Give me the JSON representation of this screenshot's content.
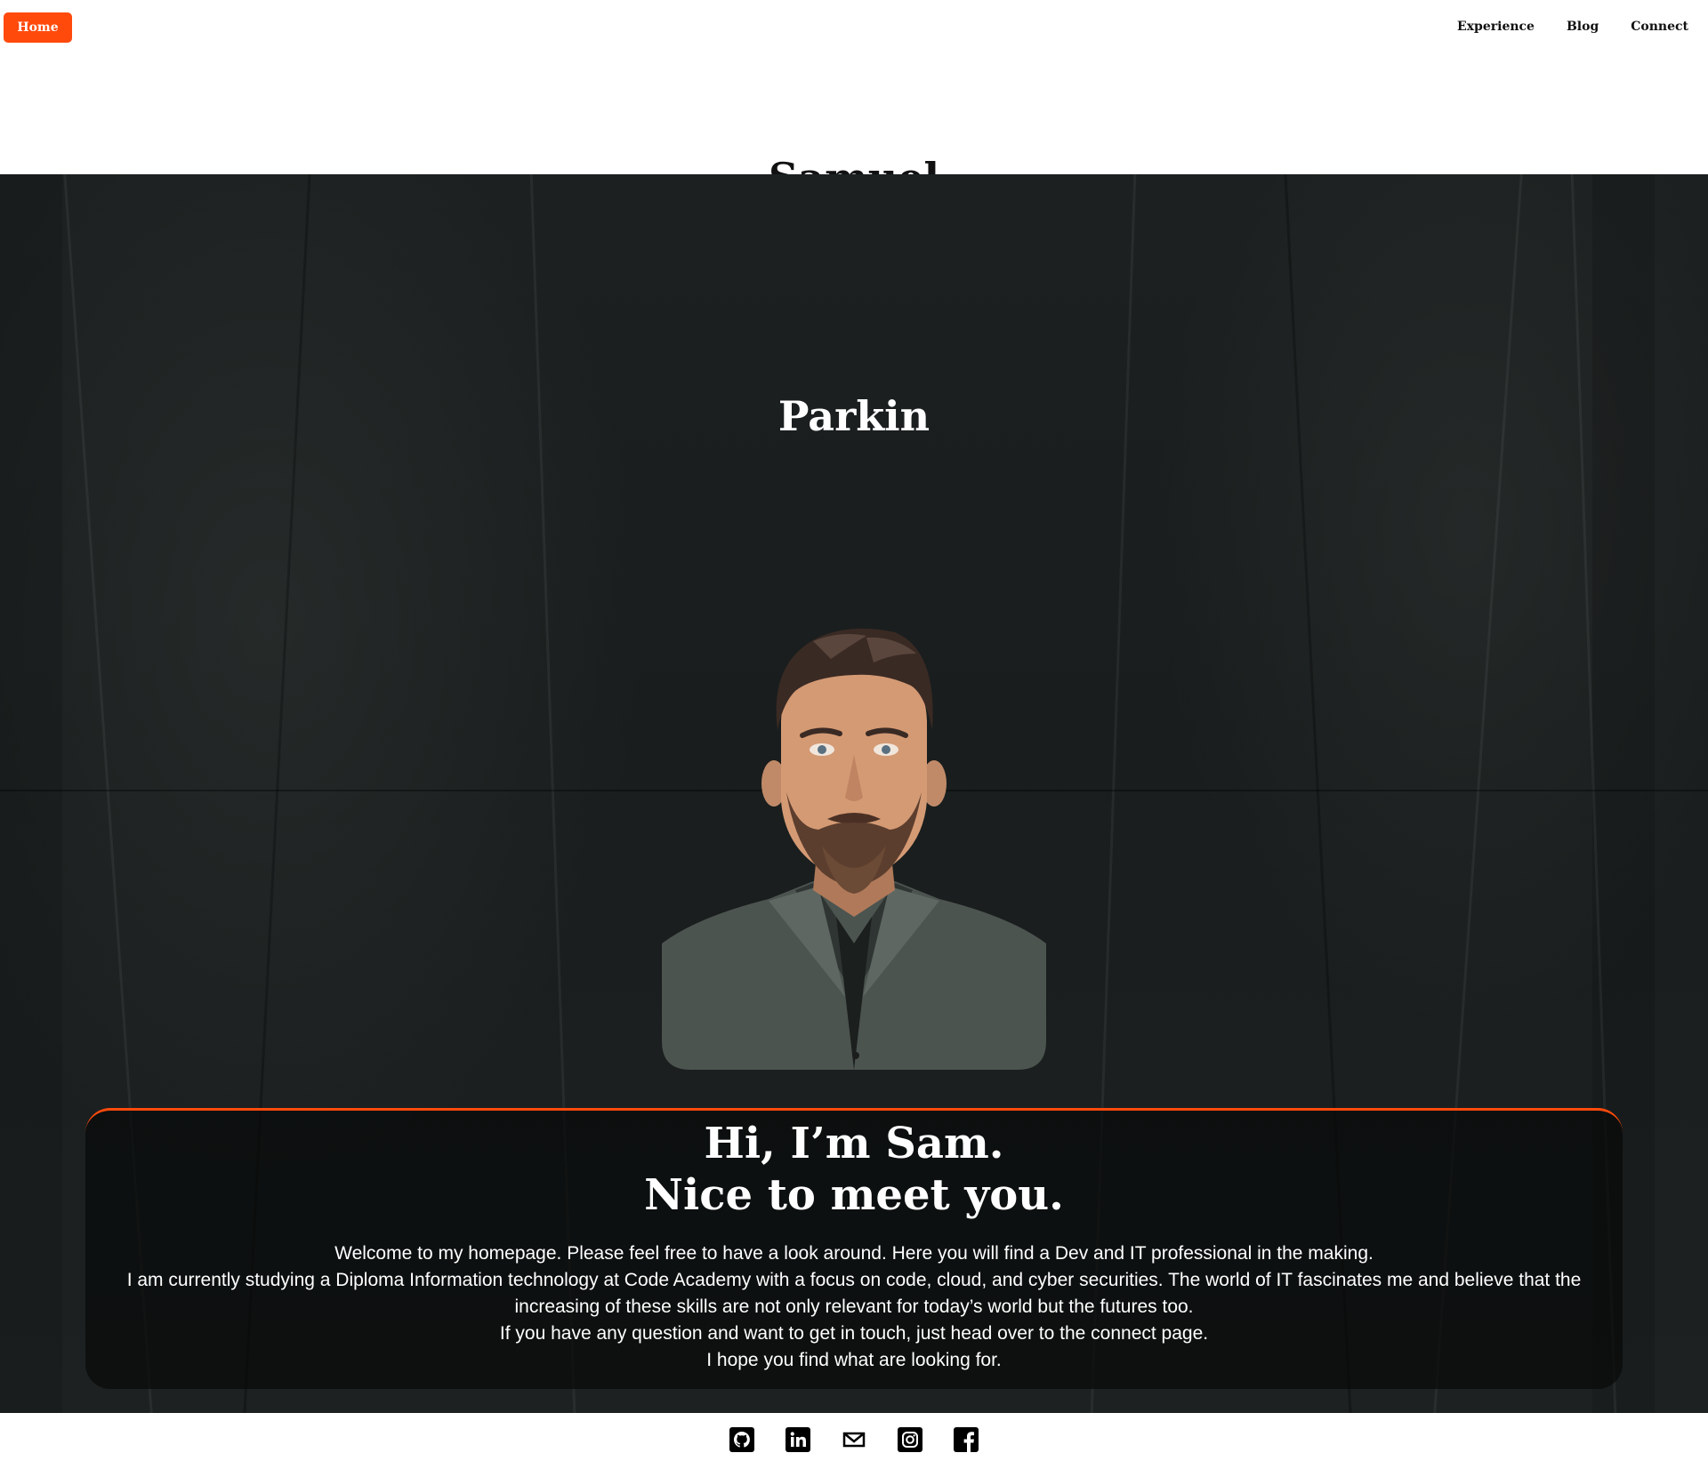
{
  "nav": {
    "home_label": "Home",
    "links": [
      {
        "label": "Experience"
      },
      {
        "label": "Blog"
      },
      {
        "label": "Connect"
      }
    ]
  },
  "hero": {
    "first_name": "Samuel",
    "last_name": "Parkin"
  },
  "intro": {
    "heading_line1": "Hi, I’m Sam.",
    "heading_line2": "Nice to meet you.",
    "paragraphs": [
      "Welcome to my homepage. Please feel free to have a look around. Here you will find a Dev and IT professional in the making.",
      "I am currently studying a Diploma Information technology at Code Academy with a focus on code, cloud, and cyber securities. The world of IT fascinates me and believe that the increasing of these skills are not only relevant for today’s world but the futures too.",
      "If you have any question and want to get in touch, just head over to the connect page.",
      "I hope you find what are looking for."
    ]
  },
  "footer": {
    "social_icons": [
      "github-icon",
      "linkedin-icon",
      "mail-icon",
      "instagram-icon",
      "facebook-icon"
    ]
  },
  "colors": {
    "accent": "#ff4a0c",
    "background_dark": "#1c2020",
    "text_light": "#ffffff"
  }
}
